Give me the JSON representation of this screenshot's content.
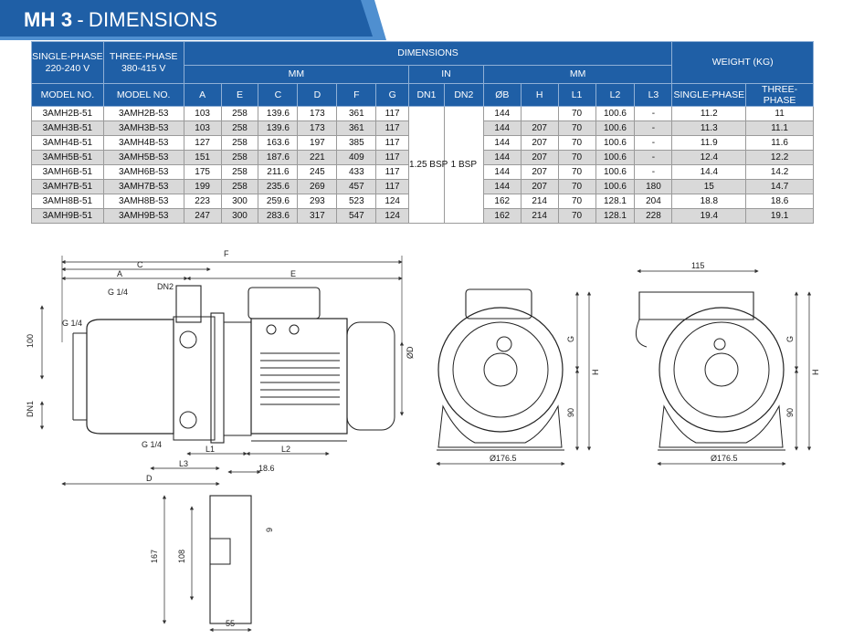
{
  "title": {
    "model": "MH 3",
    "separator": "-",
    "text": "DIMENSIONS"
  },
  "colors": {
    "banner_dark": "#1f5fa6",
    "banner_light": "#4f8fd0",
    "header_bg": "#1f5fa6",
    "row_shade": "#d9d9d9"
  },
  "table": {
    "group_headers": {
      "single_phase": "SINGLE-PHASE",
      "single_phase_voltage": "220-240 V",
      "three_phase": "THREE-PHASE",
      "three_phase_voltage": "380-415 V",
      "dimensions": "DIMENSIONS",
      "mm_left": "MM",
      "in": "IN",
      "mm_right": "MM",
      "weight": "WEIGHT (KG)"
    },
    "columns": [
      "MODEL NO.",
      "MODEL NO.",
      "A",
      "E",
      "C",
      "D",
      "F",
      "G",
      "DN1",
      "DN2",
      "ØB",
      "H",
      "L1",
      "L2",
      "L3",
      "SINGLE-PHASE",
      "THREE-PHASE"
    ],
    "dn1_value": "1.25 BSP",
    "dn2_value": "1 BSP",
    "rows": [
      {
        "single": "3AMH2B-51",
        "three": "3AMH2B-53",
        "A": "103",
        "E": "258",
        "C": "139.6",
        "D": "173",
        "F": "361",
        "G": "117",
        "B": "144",
        "H": "",
        "L1": "70",
        "L2": "100.6",
        "L3": "-",
        "w1": "11.2",
        "w3": "11"
      },
      {
        "single": "3AMH3B-51",
        "three": "3AMH3B-53",
        "A": "103",
        "E": "258",
        "C": "139.6",
        "D": "173",
        "F": "361",
        "G": "117",
        "B": "144",
        "H": "207",
        "L1": "70",
        "L2": "100.6",
        "L3": "-",
        "w1": "11.3",
        "w3": "11.1"
      },
      {
        "single": "3AMH4B-51",
        "three": "3AMH4B-53",
        "A": "127",
        "E": "258",
        "C": "163.6",
        "D": "197",
        "F": "385",
        "G": "117",
        "B": "144",
        "H": "207",
        "L1": "70",
        "L2": "100.6",
        "L3": "-",
        "w1": "11.9",
        "w3": "11.6"
      },
      {
        "single": "3AMH5B-51",
        "three": "3AMH5B-53",
        "A": "151",
        "E": "258",
        "C": "187.6",
        "D": "221",
        "F": "409",
        "G": "117",
        "B": "144",
        "H": "207",
        "L1": "70",
        "L2": "100.6",
        "L3": "-",
        "w1": "12.4",
        "w3": "12.2"
      },
      {
        "single": "3AMH6B-51",
        "three": "3AMH6B-53",
        "A": "175",
        "E": "258",
        "C": "211.6",
        "D": "245",
        "F": "433",
        "G": "117",
        "B": "144",
        "H": "207",
        "L1": "70",
        "L2": "100.6",
        "L3": "-",
        "w1": "14.4",
        "w3": "14.2"
      },
      {
        "single": "3AMH7B-51",
        "three": "3AMH7B-53",
        "A": "199",
        "E": "258",
        "C": "235.6",
        "D": "269",
        "F": "457",
        "G": "117",
        "B": "144",
        "H": "207",
        "L1": "70",
        "L2": "100.6",
        "L3": "180",
        "w1": "15",
        "w3": "14.7"
      },
      {
        "single": "3AMH8B-51",
        "three": "3AMH8B-53",
        "A": "223",
        "E": "300",
        "C": "259.6",
        "D": "293",
        "F": "523",
        "G": "124",
        "B": "162",
        "H": "214",
        "L1": "70",
        "L2": "128.1",
        "L3": "204",
        "w1": "18.8",
        "w3": "18.6"
      },
      {
        "single": "3AMH9B-51",
        "three": "3AMH9B-53",
        "A": "247",
        "E": "300",
        "C": "283.6",
        "D": "317",
        "F": "547",
        "G": "124",
        "B": "162",
        "H": "214",
        "L1": "70",
        "L2": "128.1",
        "L3": "228",
        "w1": "19.4",
        "w3": "19.1"
      }
    ]
  },
  "drawing_labels": {
    "F": "F",
    "C": "C",
    "A": "A",
    "E": "E",
    "DN2": "DN2",
    "G14_top": "G 1/4",
    "G14_left": "G 1/4",
    "G14_bottom": "G 1/4",
    "d100": "100",
    "DN1": "DN1",
    "OD": "ØD",
    "L1": "L1",
    "L2": "L2",
    "L3": "L3",
    "d186": "18.6",
    "D": "D",
    "d9": "9",
    "d108": "108",
    "d167": "167",
    "d55": "55",
    "G": "G",
    "H": "H",
    "d90_front": "90",
    "dia_front": "Ø176.5",
    "d115": "115",
    "G_back": "G",
    "H_back": "H",
    "d90_back": "90",
    "dia_back": "Ø176.5"
  }
}
